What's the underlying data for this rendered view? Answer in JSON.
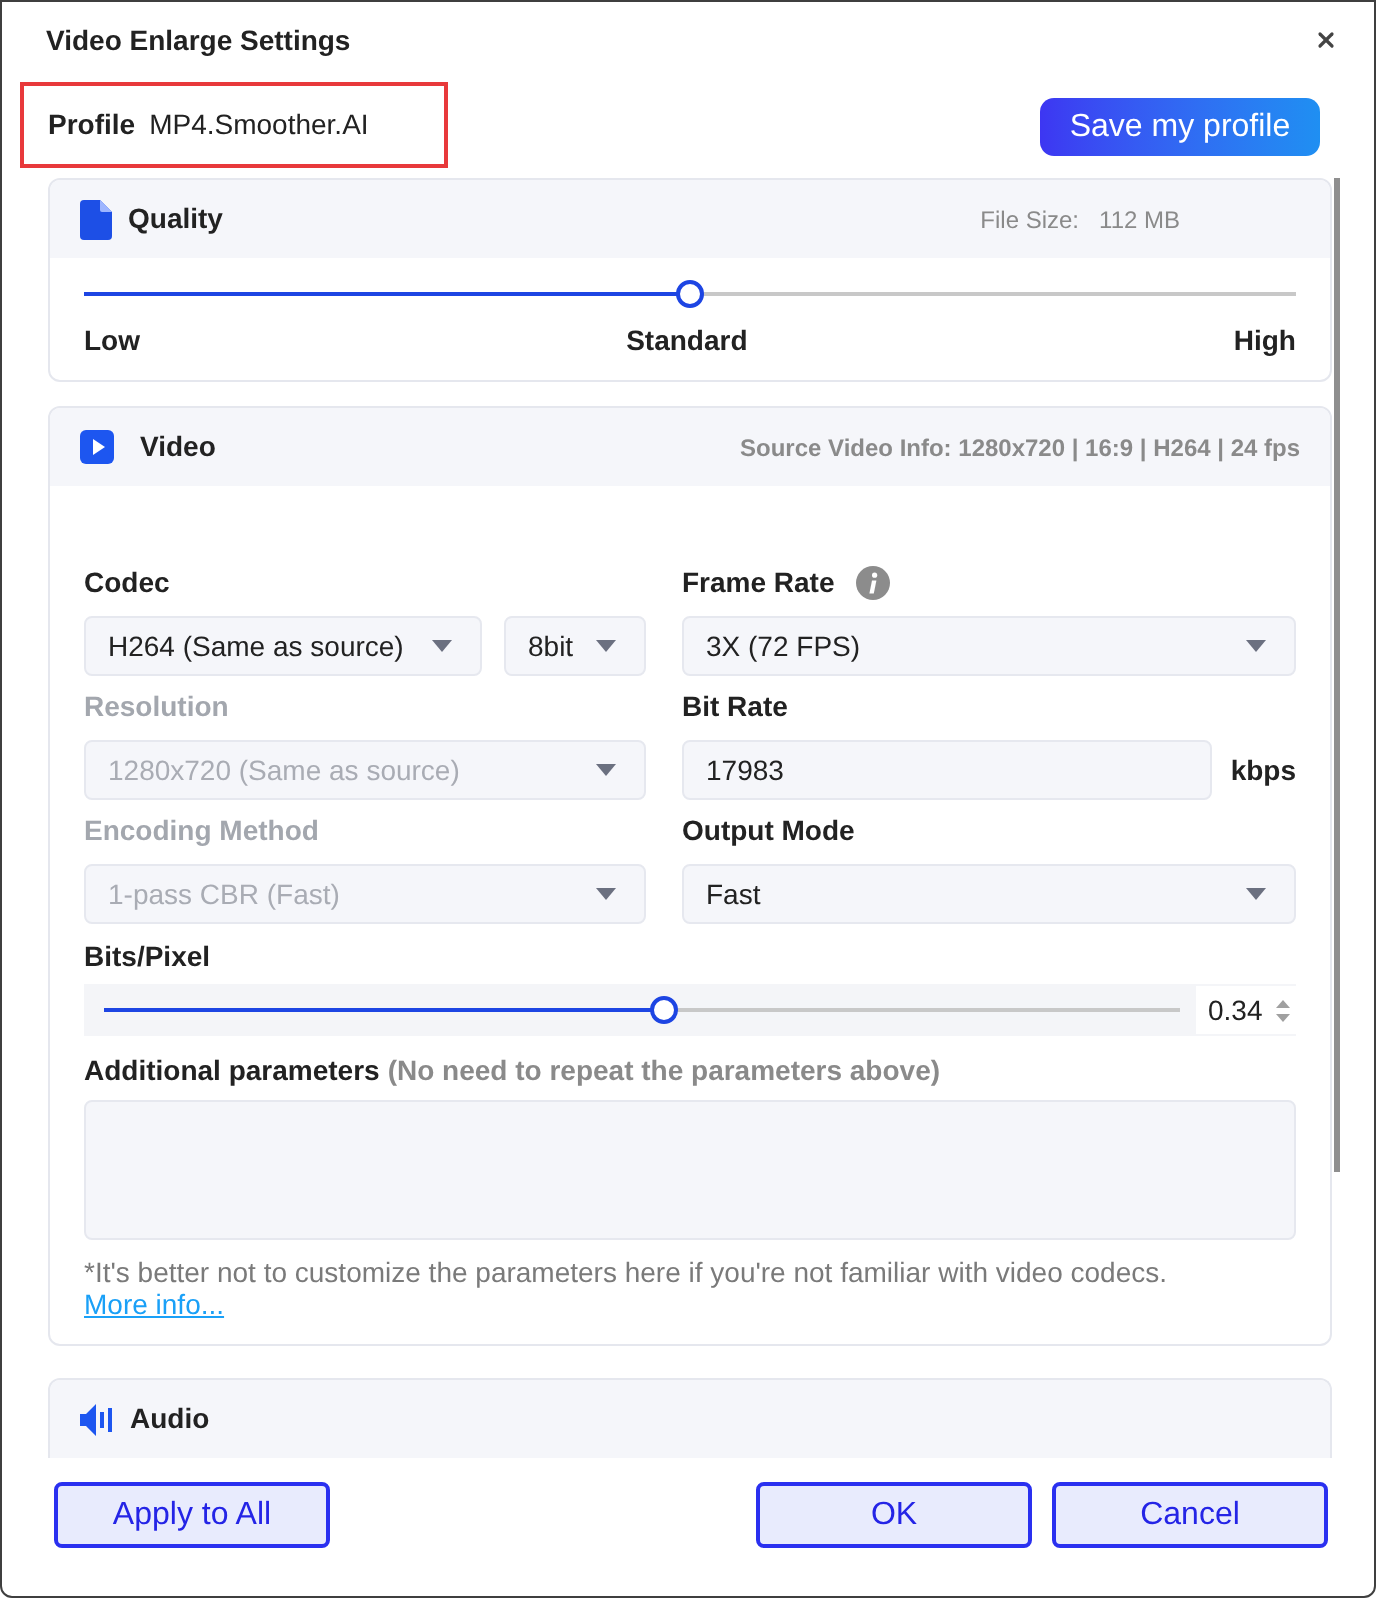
{
  "window": {
    "title": "Video Enlarge Settings"
  },
  "profile": {
    "label": "Profile",
    "value": "MP4.Smoother.AI",
    "highlighted": true
  },
  "save_button": {
    "label": "Save my profile"
  },
  "quality": {
    "title": "Quality",
    "file_size_label": "File Size:",
    "file_size": "112 MB",
    "level": 0.5,
    "scale": [
      "Low",
      "Standard",
      "High"
    ]
  },
  "video": {
    "title": "Video",
    "source_info": "Source Video Info: 1280x720 | 16:9 | H264 | 24 fps",
    "fields": [
      {
        "kind": "select_pair",
        "label": "Codec",
        "disabled": false,
        "values": [
          "H264 (Same as source)",
          "8bit"
        ]
      },
      {
        "kind": "select",
        "label": "Frame Rate",
        "disabled": false,
        "info": true,
        "value": "3X (72 FPS)"
      },
      {
        "kind": "select",
        "label": "Resolution",
        "disabled": true,
        "value": "1280x720 (Same as source)"
      },
      {
        "kind": "input",
        "label": "Bit Rate",
        "disabled": false,
        "value": "17983",
        "unit": "kbps"
      },
      {
        "kind": "select",
        "label": "Encoding Method",
        "disabled": true,
        "value": "1-pass CBR (Fast)"
      },
      {
        "kind": "select",
        "label": "Output Mode",
        "disabled": false,
        "value": "Fast"
      }
    ],
    "bits_per_pixel": {
      "label": "Bits/Pixel",
      "level": 0.52,
      "value": "0.34"
    },
    "additional_parameters": {
      "label": "Additional parameters",
      "hint": "(No need to repeat the parameters above)"
    },
    "note": {
      "text": "*It's better not to customize the parameters here if you're not familiar with video codecs.",
      "link": "More info..."
    }
  },
  "audio": {
    "title": "Audio"
  },
  "footer": {
    "left_buttons": [
      "Apply to All"
    ],
    "right_buttons": [
      "OK",
      "Cancel"
    ]
  }
}
